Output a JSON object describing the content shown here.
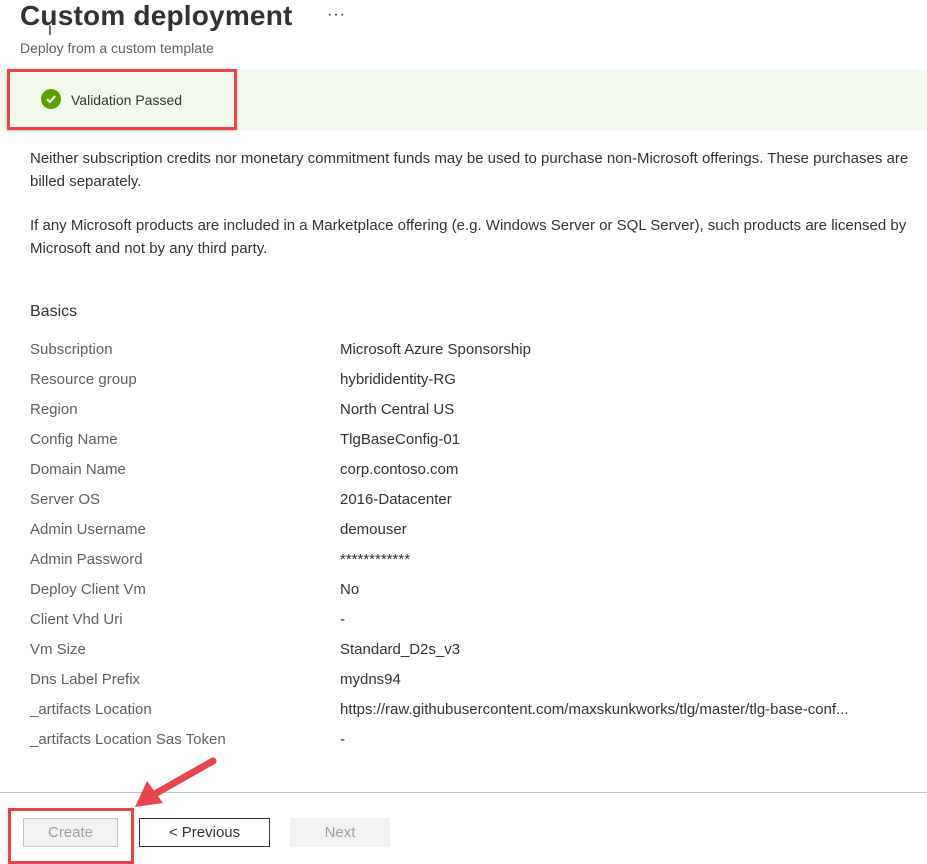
{
  "header": {
    "title": "Custom deployment",
    "more_label": "···",
    "subtitle": "Deploy from a custom template"
  },
  "validation": {
    "icon": "checkmark-circle-icon",
    "text": "Validation Passed",
    "color": "#57a300"
  },
  "notices": [
    "Neither subscription credits nor monetary commitment funds may be used to purchase non-Microsoft offerings. These purchases are billed separately.",
    "If any Microsoft products are included in a Marketplace offering (e.g. Windows Server or SQL Server), such products are licensed by Microsoft and not by any third party."
  ],
  "basics": {
    "title": "Basics",
    "rows": [
      {
        "label": "Subscription",
        "value": "Microsoft Azure Sponsorship"
      },
      {
        "label": "Resource group",
        "value": "hybrididentity-RG"
      },
      {
        "label": "Region",
        "value": "North Central US"
      },
      {
        "label": "Config Name",
        "value": "TlgBaseConfig-01"
      },
      {
        "label": "Domain Name",
        "value": "corp.contoso.com"
      },
      {
        "label": "Server OS",
        "value": "2016-Datacenter"
      },
      {
        "label": "Admin Username",
        "value": "demouser"
      },
      {
        "label": "Admin Password",
        "value": "************"
      },
      {
        "label": "Deploy Client Vm",
        "value": "No"
      },
      {
        "label": "Client Vhd Uri",
        "value": "-"
      },
      {
        "label": "Vm Size",
        "value": "Standard_D2s_v3"
      },
      {
        "label": "Dns Label Prefix",
        "value": "mydns94"
      },
      {
        "label": "_artifacts Location",
        "value": "https://raw.githubusercontent.com/maxskunkworks/tlg/master/tlg-base-conf..."
      },
      {
        "label": "_artifacts Location Sas Token",
        "value": "-"
      }
    ]
  },
  "footer": {
    "create_label": "Create",
    "previous_label": "< Previous",
    "next_label": "Next"
  },
  "annotations": {
    "highlight_color": "#e8454b"
  }
}
